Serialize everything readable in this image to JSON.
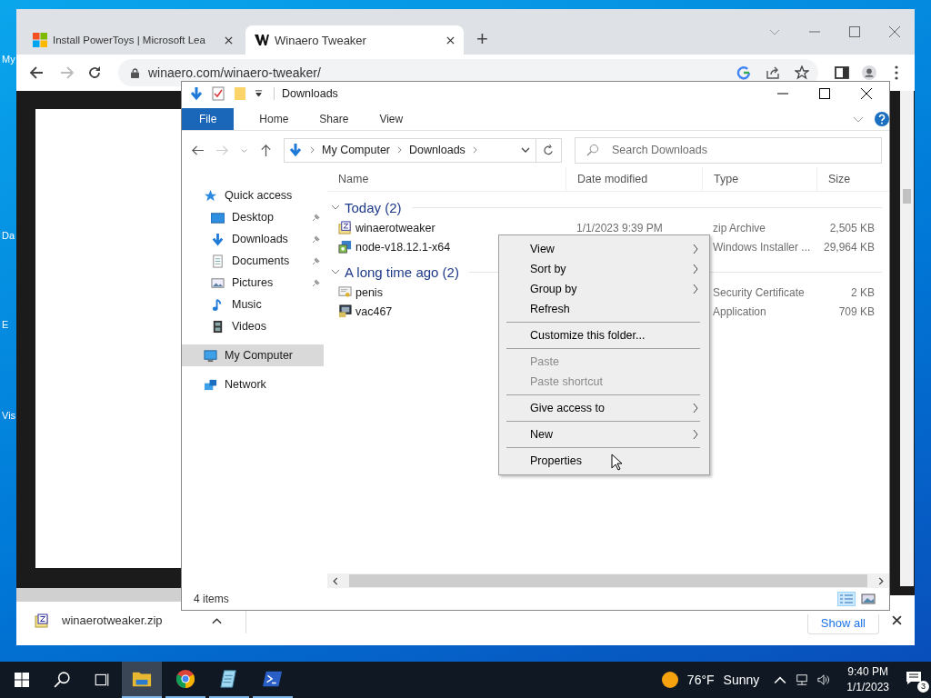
{
  "desktop_icons": [
    {
      "label": "My"
    },
    {
      "label": "Da"
    },
    {
      "label": "E"
    },
    {
      "label": "Vis"
    }
  ],
  "browser": {
    "tabs": [
      {
        "title": "Install PowerToys | Microsoft Lea",
        "selected": false
      },
      {
        "title": "Winaero Tweaker",
        "selected": true
      }
    ],
    "new_tab": "+",
    "address": "winaero.com/winaero-tweaker/",
    "download": {
      "file": "winaerotweaker.zip",
      "show_all": "Show all"
    }
  },
  "explorer": {
    "title": "Downloads",
    "ribbon_tabs": [
      {
        "label": "File",
        "selected": true
      },
      {
        "label": "Home",
        "selected": false
      },
      {
        "label": "Share",
        "selected": false
      },
      {
        "label": "View",
        "selected": false
      }
    ],
    "breadcrumb": [
      "My Computer",
      "Downloads"
    ],
    "search": {
      "placeholder": "Search Downloads"
    },
    "nav": [
      {
        "label": "Quick access",
        "selected": false,
        "children": [
          {
            "label": "Desktop",
            "pinned": true,
            "selected": false
          },
          {
            "label": "Downloads",
            "pinned": true,
            "selected": false
          },
          {
            "label": "Documents",
            "pinned": true,
            "selected": false
          },
          {
            "label": "Pictures",
            "pinned": true,
            "selected": false
          },
          {
            "label": "Music",
            "pinned": false,
            "selected": false
          },
          {
            "label": "Videos",
            "pinned": false,
            "selected": false
          }
        ]
      },
      {
        "label": "My Computer",
        "selected": true
      },
      {
        "label": "Network",
        "selected": false
      }
    ],
    "columns": [
      "Name",
      "Date modified",
      "Type",
      "Size"
    ],
    "groups": [
      {
        "title": "Today (2)",
        "expanded": true,
        "files": [
          {
            "name": "winaerotweaker",
            "date": "1/1/2023 9:39 PM",
            "type": "zip Archive",
            "size": "2,505 KB"
          },
          {
            "name": "node-v18.12.1-x64",
            "type": "Windows Installer ...",
            "size": "29,964 KB"
          }
        ]
      },
      {
        "title": "A long time ago (2)",
        "expanded": true,
        "files": [
          {
            "name": "penis",
            "type": "Security Certificate",
            "size": "2 KB"
          },
          {
            "name": "vac467",
            "type": "Application",
            "size": "709 KB"
          }
        ]
      }
    ],
    "status": "4 items"
  },
  "context_menu": [
    {
      "kind": "item",
      "label": "View",
      "submenu": true,
      "disabled": false
    },
    {
      "kind": "item",
      "label": "Sort by",
      "submenu": true,
      "disabled": false
    },
    {
      "kind": "item",
      "label": "Group by",
      "submenu": true,
      "disabled": false
    },
    {
      "kind": "item",
      "label": "Refresh",
      "submenu": false,
      "disabled": false
    },
    {
      "kind": "separator"
    },
    {
      "kind": "item",
      "label": "Customize this folder...",
      "submenu": false,
      "disabled": false
    },
    {
      "kind": "separator"
    },
    {
      "kind": "item",
      "label": "Paste",
      "submenu": false,
      "disabled": true
    },
    {
      "kind": "item",
      "label": "Paste shortcut",
      "submenu": false,
      "disabled": true
    },
    {
      "kind": "separator"
    },
    {
      "kind": "item",
      "label": "Give access to",
      "submenu": true,
      "disabled": false
    },
    {
      "kind": "separator"
    },
    {
      "kind": "item",
      "label": "New",
      "submenu": true,
      "disabled": false
    },
    {
      "kind": "separator"
    },
    {
      "kind": "item",
      "label": "Properties",
      "submenu": false,
      "disabled": false
    }
  ],
  "taskbar": {
    "apps": [
      {
        "selected": true
      },
      {
        "selected": false
      },
      {
        "selected": false
      },
      {
        "selected": false
      }
    ],
    "weather": {
      "temp": "76°F",
      "condition": "Sunny"
    },
    "time": "9:40 PM",
    "date": "1/1/2023",
    "notifications": "3"
  }
}
